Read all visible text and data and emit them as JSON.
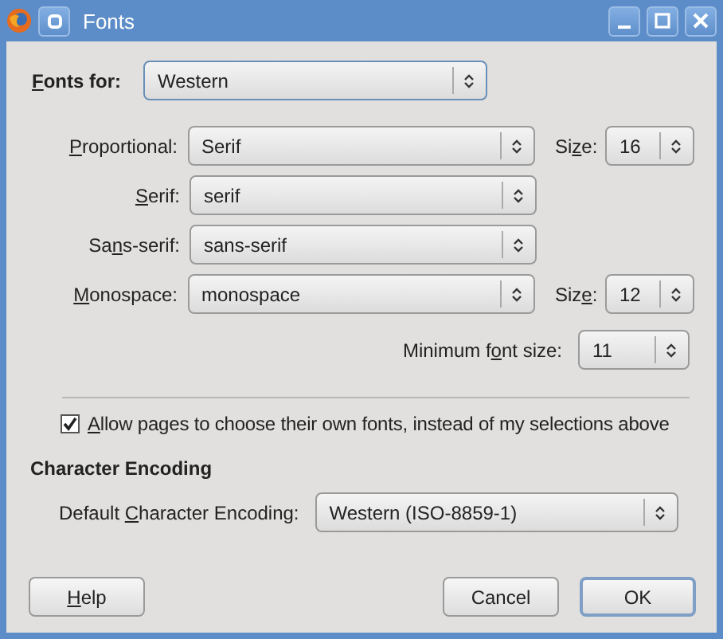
{
  "window": {
    "title": "Fonts"
  },
  "fonts_for": {
    "label": {
      "key": "F",
      "post": "onts for:"
    },
    "value": "Western"
  },
  "font_rows": [
    {
      "label": {
        "key": "P",
        "post": "roportional:"
      },
      "value": "Serif",
      "size": {
        "label": {
          "pre": "Si",
          "key": "z",
          "post": "e:"
        },
        "value": "16"
      }
    },
    {
      "label": {
        "key": "S",
        "post": "erif:"
      },
      "value": "serif"
    },
    {
      "label": {
        "pre": "Sa",
        "key": "n",
        "post": "s-serif:"
      },
      "value": "sans-serif"
    },
    {
      "label": {
        "key": "M",
        "post": "onospace:"
      },
      "value": "monospace",
      "size": {
        "label": {
          "pre": "Siz",
          "key": "e",
          "post": ":"
        },
        "value": "12"
      }
    }
  ],
  "minimum_font_size": {
    "label": {
      "pre": "Minimum f",
      "key": "o",
      "post": "nt size:"
    },
    "value": "11"
  },
  "allow_pages": {
    "label": {
      "key": "A",
      "post": "llow pages to choose their own fonts, instead of my selections above"
    },
    "checked": true
  },
  "character_encoding": {
    "heading": "Character Encoding",
    "label": {
      "pre": "Default ",
      "key": "C",
      "post": "haracter Encoding:"
    },
    "value": "Western (ISO-8859-1)"
  },
  "buttons_left": [
    {
      "label": {
        "key": "H",
        "post": "elp"
      },
      "default": false
    }
  ],
  "buttons_right": [
    {
      "label": {
        "pre": "Cancel"
      },
      "default": false
    },
    {
      "label": {
        "pre": "OK"
      },
      "default": true
    }
  ]
}
